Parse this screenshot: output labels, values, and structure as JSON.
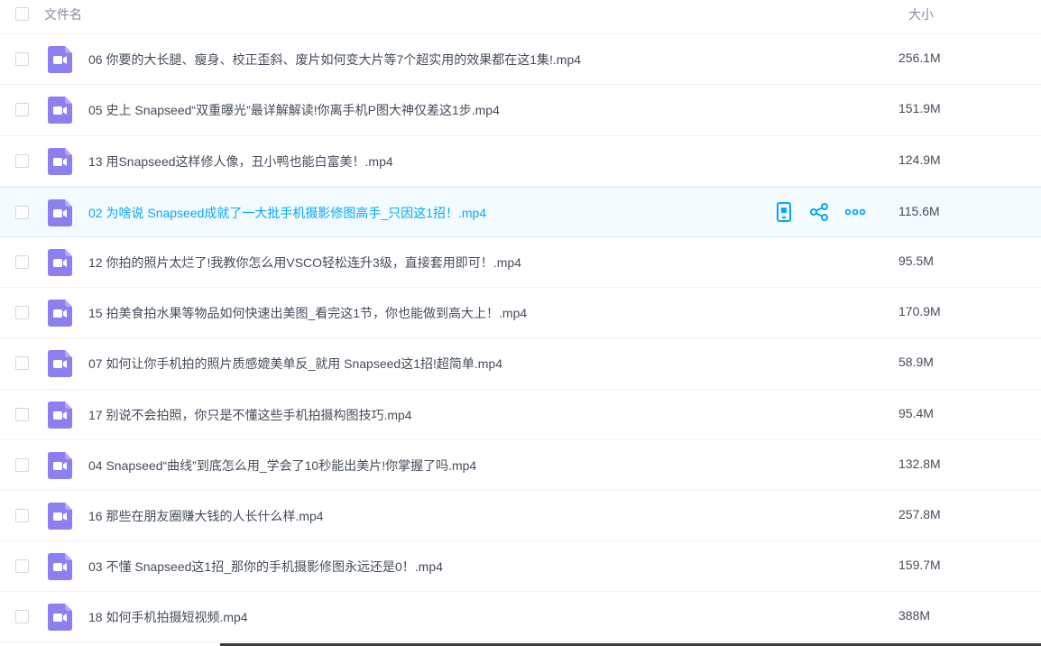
{
  "header": {
    "name_label": "文件名",
    "size_label": "大小"
  },
  "files": [
    {
      "name": "06 你要的大长腿、瘦身、校正歪斜、废片如何变大片等7个超实用的效果都在这1集!.mp4",
      "size": "256.1M"
    },
    {
      "name": "05 史上 Snapseed“双重曝光”最详解解读!你离手机P图大神仅差这1步.mp4",
      "size": "151.9M"
    },
    {
      "name": "13 用Snapseed这样修人像，丑小鸭也能白富美！.mp4",
      "size": "124.9M"
    },
    {
      "name": "02 为啥说 Snapseed成就了一大批手机摄影修图高手_只因这1招！.mp4",
      "size": "115.6M"
    },
    {
      "name": "12 你拍的照片太烂了!我教你怎么用VSCO轻松连升3级，直接套用即可！.mp4",
      "size": "95.5M"
    },
    {
      "name": "15 拍美食拍水果等物品如何快速出美图_看完这1节，你也能做到高大上！.mp4",
      "size": "170.9M"
    },
    {
      "name": "07 如何让你手机拍的照片质感媲美单反_就用 Snapseed这1招!超简单.mp4",
      "size": "58.9M"
    },
    {
      "name": "17 别说不会拍照，你只是不懂这些手机拍摄构图技巧.mp4",
      "size": "95.4M"
    },
    {
      "name": "04 Snapseed“曲线”到底怎么用_学会了10秒能出美片!你掌握了吗.mp4",
      "size": "132.8M"
    },
    {
      "name": "16 那些在朋友圈赚大钱的人长什么样.mp4",
      "size": "257.8M"
    },
    {
      "name": "03 不懂 Snapseed这1招_那你的手机摄影修图永远还是0！.mp4",
      "size": "159.7M"
    },
    {
      "name": "18 如何手机拍摄短视频.mp4",
      "size": "388M"
    }
  ],
  "hover_index": 3,
  "row_actions": [
    "phone-icon",
    "share-icon",
    "more-icon"
  ],
  "colors": {
    "video_icon": "#8c7ff0",
    "accent": "#06a7ff",
    "hover_bg": "#f4fbff"
  }
}
